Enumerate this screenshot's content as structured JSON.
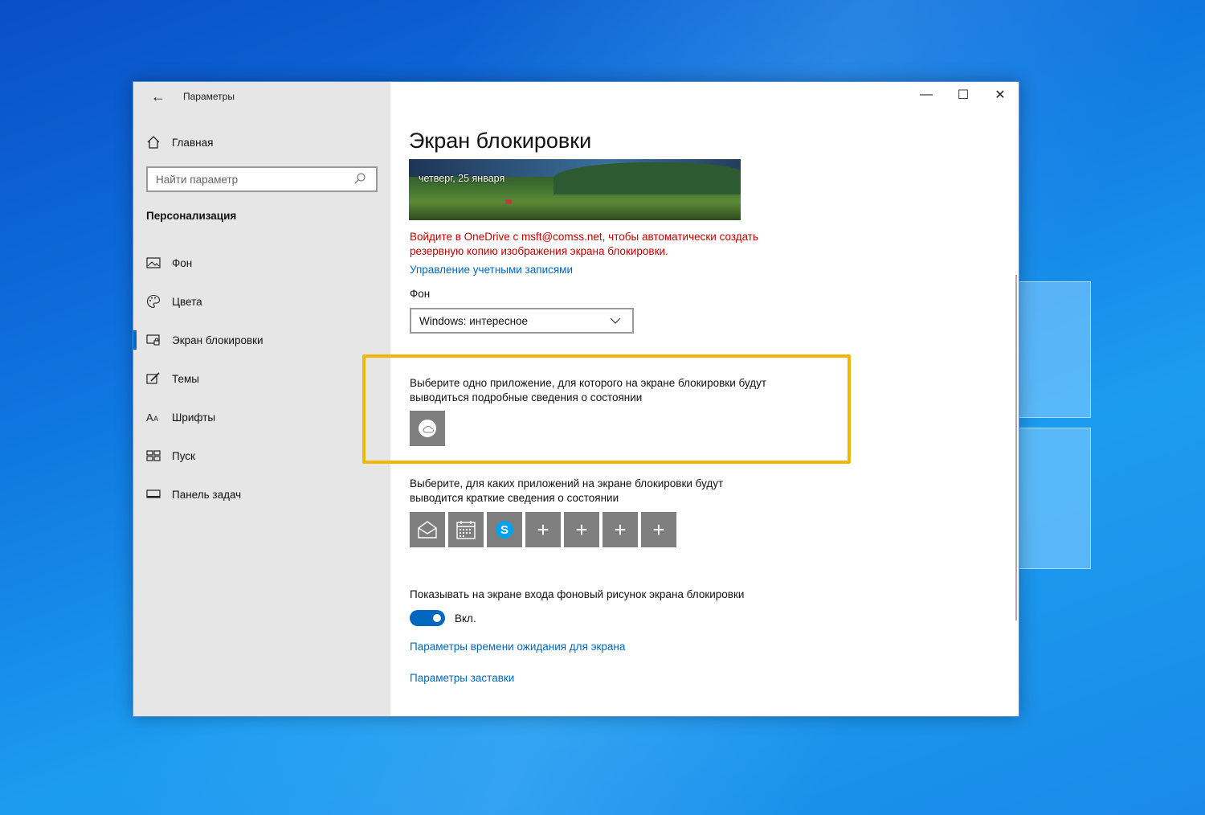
{
  "window": {
    "title": "Параметры",
    "back": "←",
    "minimize": "—",
    "maximize": "☐",
    "close": "✕"
  },
  "sidebar": {
    "home": "Главная",
    "search_placeholder": "Найти параметр",
    "section": "Персонализация",
    "items": [
      {
        "label": "Фон",
        "icon": "image-icon"
      },
      {
        "label": "Цвета",
        "icon": "palette-icon"
      },
      {
        "label": "Экран блокировки",
        "icon": "lock-screen-icon",
        "active": true
      },
      {
        "label": "Темы",
        "icon": "brush-icon"
      },
      {
        "label": "Шрифты",
        "icon": "fonts-icon"
      },
      {
        "label": "Пуск",
        "icon": "start-icon"
      },
      {
        "label": "Панель задач",
        "icon": "taskbar-icon"
      }
    ]
  },
  "main": {
    "title": "Экран блокировки",
    "preview_date": "четверг, 25 января",
    "warning": "Войдите в OneDrive с msft@comss.net, чтобы автоматически создать резервную копию изображения экрана блокировки.",
    "manage_link": "Управление учетными записями",
    "background_label": "Фон",
    "background_value": "Windows: интересное",
    "detailed_status_text": "Выберите одно приложение, для которого на экране блокировки будут выводиться подробные сведения о состоянии",
    "quick_status_text": "Выберите, для каких приложений на экране блокировки будут выводится краткие сведения о состоянии",
    "quick_apps": [
      "mail-icon",
      "calendar-icon",
      "skype-icon",
      "plus",
      "plus",
      "plus",
      "plus"
    ],
    "plus_symbol": "+",
    "signin_text": "Показывать на экране входа фоновый рисунок экрана блокировки",
    "toggle_label": "Вкл.",
    "toggle_on": true,
    "timeout_link": "Параметры времени ожидания для экрана",
    "screensaver_link": "Параметры заставки"
  },
  "colors": {
    "accent": "#0067c0",
    "warning": "#c40000",
    "highlight": "#f2b705"
  }
}
